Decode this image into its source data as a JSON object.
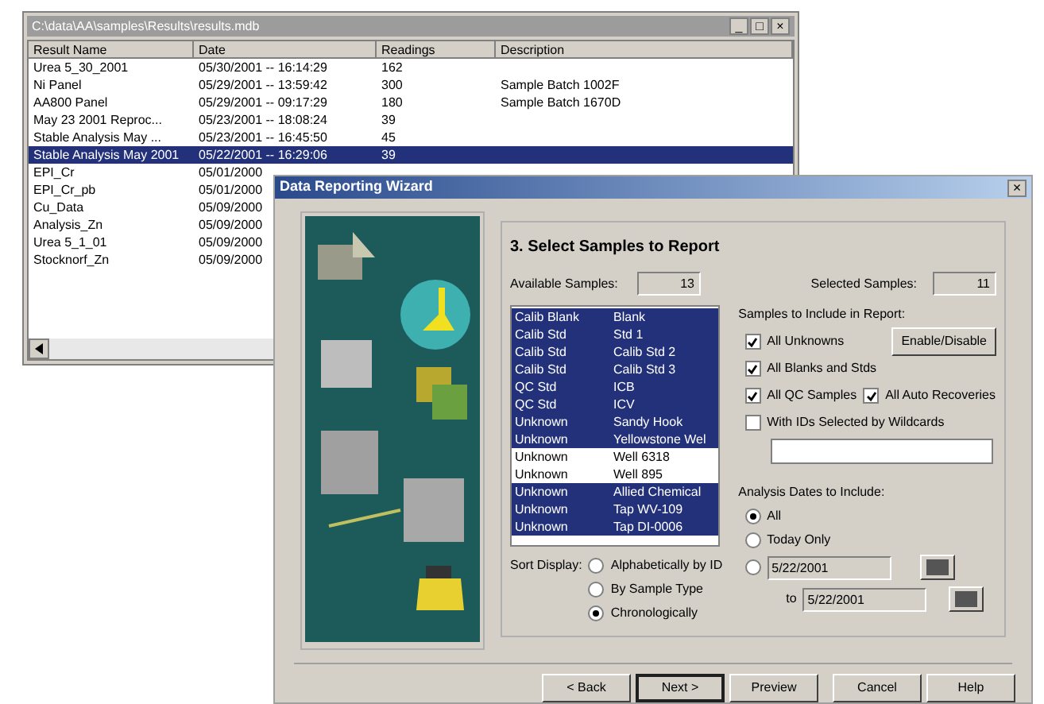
{
  "results_window": {
    "title": "C:\\data\\AA\\samples\\Results\\results.mdb",
    "controls": [
      "_",
      "□",
      "×"
    ],
    "columns": [
      "Result Name",
      "Date",
      "Readings",
      "Description"
    ],
    "rows": [
      {
        "cells": [
          "Urea 5_30_2001",
          "05/30/2001 -- 16:14:29",
          "162",
          ""
        ],
        "selected": false
      },
      {
        "cells": [
          "Ni Panel",
          "05/29/2001 -- 13:59:42",
          "300",
          "Sample Batch 1002F"
        ],
        "selected": false
      },
      {
        "cells": [
          "AA800 Panel",
          "05/29/2001 -- 09:17:29",
          "180",
          "Sample Batch 1670D"
        ],
        "selected": false
      },
      {
        "cells": [
          "May 23 2001 Reproc...",
          "05/23/2001 -- 18:08:24",
          "39",
          ""
        ],
        "selected": false
      },
      {
        "cells": [
          "Stable Analysis May ...",
          "05/23/2001 -- 16:45:50",
          "45",
          ""
        ],
        "selected": false
      },
      {
        "cells": [
          "Stable Analysis May 2001",
          "05/22/2001 -- 16:29:06",
          "39",
          ""
        ],
        "selected": true
      },
      {
        "cells": [
          "EPI_Cr",
          "05/01/2000"
        ],
        "selected": false
      },
      {
        "cells": [
          "EPI_Cr_pb",
          "05/01/2000"
        ],
        "selected": false
      },
      {
        "cells": [
          "Cu_Data",
          "05/09/2000"
        ],
        "selected": false
      },
      {
        "cells": [
          "Analysis_Zn",
          "05/09/2000"
        ],
        "selected": false
      },
      {
        "cells": [
          "Urea 5_1_01",
          "05/09/2000"
        ],
        "selected": false
      },
      {
        "cells": [
          "Stocknorf_Zn",
          "05/09/2000"
        ],
        "selected": false
      }
    ]
  },
  "wizard": {
    "title": "Data Reporting Wizard",
    "close": "×",
    "heading": "3. Select Samples to Report",
    "available_label": "Available Samples:",
    "available": "13",
    "selected_label": "Selected Samples:",
    "selected_count": "11",
    "samples": [
      {
        "type": "Calib Blank",
        "id": "Blank",
        "selected": true
      },
      {
        "type": "Calib Std",
        "id": "Std 1",
        "selected": true
      },
      {
        "type": "Calib Std",
        "id": "Calib Std 2",
        "selected": true
      },
      {
        "type": "Calib Std",
        "id": "Calib Std 3",
        "selected": true
      },
      {
        "type": "QC Std",
        "id": "ICB",
        "selected": true
      },
      {
        "type": "QC Std",
        "id": "ICV",
        "selected": true
      },
      {
        "type": "Unknown",
        "id": "Sandy Hook",
        "selected": true
      },
      {
        "type": "Unknown",
        "id": "Yellowstone Wel",
        "selected": true
      },
      {
        "type": "Unknown",
        "id": "Well 6318",
        "selected": false
      },
      {
        "type": "Unknown",
        "id": "Well 895",
        "selected": false
      },
      {
        "type": "Unknown",
        "id": "Allied Chemical",
        "selected": true
      },
      {
        "type": "Unknown",
        "id": "Tap WV-109",
        "selected": true
      },
      {
        "type": "Unknown",
        "id": "Tap DI-0006",
        "selected": true
      }
    ],
    "include_label": "Samples to Include in Report:",
    "include": [
      {
        "label": "All Unknowns",
        "checked": true
      },
      {
        "label": "All Blanks and Stds",
        "checked": true
      },
      {
        "label": "All QC Samples",
        "checked": true
      },
      {
        "label": "All Auto Recoveries",
        "checked": true
      },
      {
        "label": "With IDs Selected by Wildcards",
        "checked": false
      }
    ],
    "enable_button": "Enable/Disable",
    "dates_label": "Analysis Dates to Include:",
    "dates": [
      {
        "label": "All",
        "selected": true
      },
      {
        "label": "Today Only",
        "selected": false
      },
      {
        "value": "5/22/2001",
        "selected": false
      }
    ],
    "to_label": "to",
    "to_value": "5/22/2001",
    "sort_label": "Sort Display:",
    "sort": [
      {
        "label": "Alphabetically by ID",
        "selected": false
      },
      {
        "label": "By Sample Type",
        "selected": false
      },
      {
        "label": "Chronologically",
        "selected": true
      }
    ],
    "buttons": [
      {
        "label": "< Back",
        "default": false
      },
      {
        "label": "Next >",
        "default": true
      },
      {
        "label": "Preview",
        "default": false
      },
      {
        "label": "Cancel",
        "default": false
      },
      {
        "label": "Help",
        "default": false
      }
    ]
  }
}
